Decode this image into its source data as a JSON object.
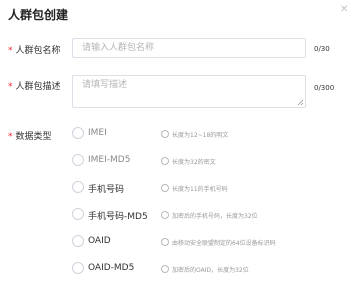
{
  "dialog": {
    "title": "人群包创建",
    "close_icon": "close-icon"
  },
  "form": {
    "name": {
      "required_mark": "*",
      "label": "人群包名称",
      "placeholder": "请输入人群包名称",
      "count": "0/30"
    },
    "description": {
      "required_mark": "*",
      "label": "人群包描述",
      "placeholder": "请填写描述",
      "count": "0/300"
    },
    "data_type": {
      "required_mark": "*",
      "label": "数据类型",
      "options": [
        {
          "label": "IMEI",
          "hint": "长度为12~18的明文"
        },
        {
          "label": "IMEI-MD5",
          "hint": "长度为32的密文"
        },
        {
          "label": "手机号码",
          "hint": "长度为11的手机号码"
        },
        {
          "label": "手机号码-MD5",
          "hint": "加密后的手机号码，长度为32位"
        },
        {
          "label": "OAID",
          "hint": "由移动安全联盟制定的64位设备标识码"
        },
        {
          "label": "OAID-MD5",
          "hint": "加密后的OAID，长度为32位"
        }
      ]
    }
  },
  "colors": {
    "required": "#f5222d",
    "border": "#dcdfe6",
    "placeholder": "#b5b5b5",
    "hint": "#9a9a9a"
  }
}
